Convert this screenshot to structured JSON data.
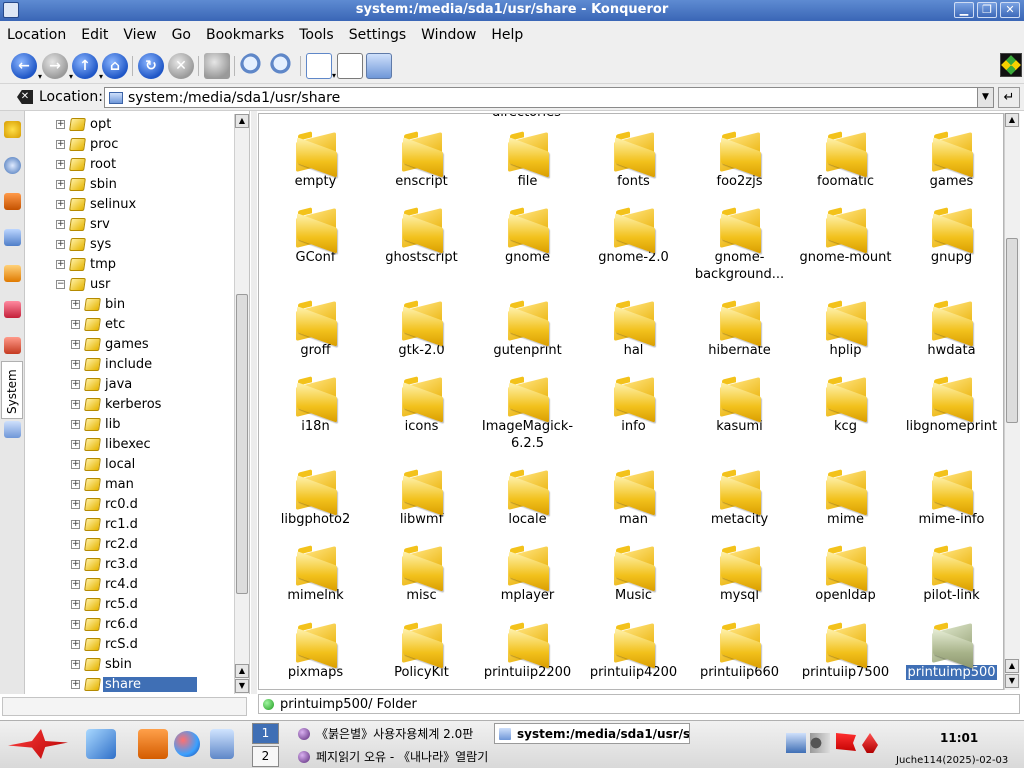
{
  "window": {
    "title": "system:/media/sda1/usr/share - Konqueror",
    "minimize_glyph": "▁",
    "maximize_glyph": "❐",
    "close_glyph": "✕"
  },
  "menubar": {
    "items": [
      "Location",
      "Edit",
      "View",
      "Go",
      "Bookmarks",
      "Tools",
      "Settings",
      "Window",
      "Help"
    ]
  },
  "toolbar": {
    "buttons": [
      "back-icon",
      "forward-icon",
      "up-icon",
      "home-icon",
      "reload-icon",
      "stop-icon",
      "print-icon",
      "zoom-in-icon",
      "zoom-out-icon",
      "icon-view-icon",
      "detail-view-icon",
      "preview-icon"
    ],
    "glyphs": {
      "back": "←",
      "forward": "→",
      "up": "↑",
      "home": "⌂",
      "reload": "↻",
      "stop": "✕"
    }
  },
  "location": {
    "label": "Location:",
    "value": "system:/media/sda1/usr/share",
    "go_glyph": "↵"
  },
  "sidebar": {
    "system_tab": "System",
    "tree": [
      {
        "label": "opt",
        "level": 0
      },
      {
        "label": "proc",
        "level": 0
      },
      {
        "label": "root",
        "level": 0
      },
      {
        "label": "sbin",
        "level": 0
      },
      {
        "label": "selinux",
        "level": 0
      },
      {
        "label": "srv",
        "level": 0
      },
      {
        "label": "sys",
        "level": 0
      },
      {
        "label": "tmp",
        "level": 0
      },
      {
        "label": "usr",
        "level": 0,
        "expanded": true
      },
      {
        "label": "bin",
        "level": 1
      },
      {
        "label": "etc",
        "level": 1
      },
      {
        "label": "games",
        "level": 1
      },
      {
        "label": "include",
        "level": 1
      },
      {
        "label": "java",
        "level": 1
      },
      {
        "label": "kerberos",
        "level": 1
      },
      {
        "label": "lib",
        "level": 1
      },
      {
        "label": "libexec",
        "level": 1
      },
      {
        "label": "local",
        "level": 1
      },
      {
        "label": "man",
        "level": 1
      },
      {
        "label": "rc0.d",
        "level": 1
      },
      {
        "label": "rc1.d",
        "level": 1
      },
      {
        "label": "rc2.d",
        "level": 1
      },
      {
        "label": "rc3.d",
        "level": 1
      },
      {
        "label": "rc4.d",
        "level": 1
      },
      {
        "label": "rc5.d",
        "level": 1
      },
      {
        "label": "rc6.d",
        "level": 1
      },
      {
        "label": "rcS.d",
        "level": 1
      },
      {
        "label": "sbin",
        "level": 1
      },
      {
        "label": "share",
        "level": 1,
        "selected": true
      }
    ]
  },
  "iconview": {
    "clipped_label": "directories",
    "folders": [
      "empty",
      "enscript",
      "file",
      "fonts",
      "foo2zjs",
      "foomatic",
      "games",
      "GConf",
      "ghostscript",
      "gnome",
      "gnome-2.0",
      "gnome-background...",
      "gnome-mount",
      "gnupg",
      "groff",
      "gtk-2.0",
      "gutenprint",
      "hal",
      "hibernate",
      "hplip",
      "hwdata",
      "i18n",
      "icons",
      "ImageMagick-6.2.5",
      "info",
      "kasumi",
      "kcg",
      "libgnomeprint",
      "libgphoto2",
      "libwmf",
      "locale",
      "man",
      "metacity",
      "mime",
      "mime-info",
      "mimelnk",
      "misc",
      "mplayer",
      "Music",
      "mysql",
      "openldap",
      "pilot-link",
      "pixmaps",
      "PolicyKit",
      "printuiip2200",
      "printuiip4200",
      "printuiip660",
      "printuiip7500",
      "printuimp500"
    ],
    "selected": "printuimp500"
  },
  "status": {
    "text": "printuimp500/  Folder"
  },
  "taskbar": {
    "pager": [
      "1",
      "2"
    ],
    "tasks": [
      "《붉은별》사용자용체계 2.0판",
      "system:/media/sda1/usr/share - Konqueror",
      "페지읽기 오유 - 《내나라》열람기"
    ],
    "clock": "11:01",
    "date": "Juche114(2025)-02-03"
  },
  "colors": {
    "titlebar": "#3a66b6",
    "selection": "#3f6fb5",
    "folder": "#f2c11c"
  }
}
